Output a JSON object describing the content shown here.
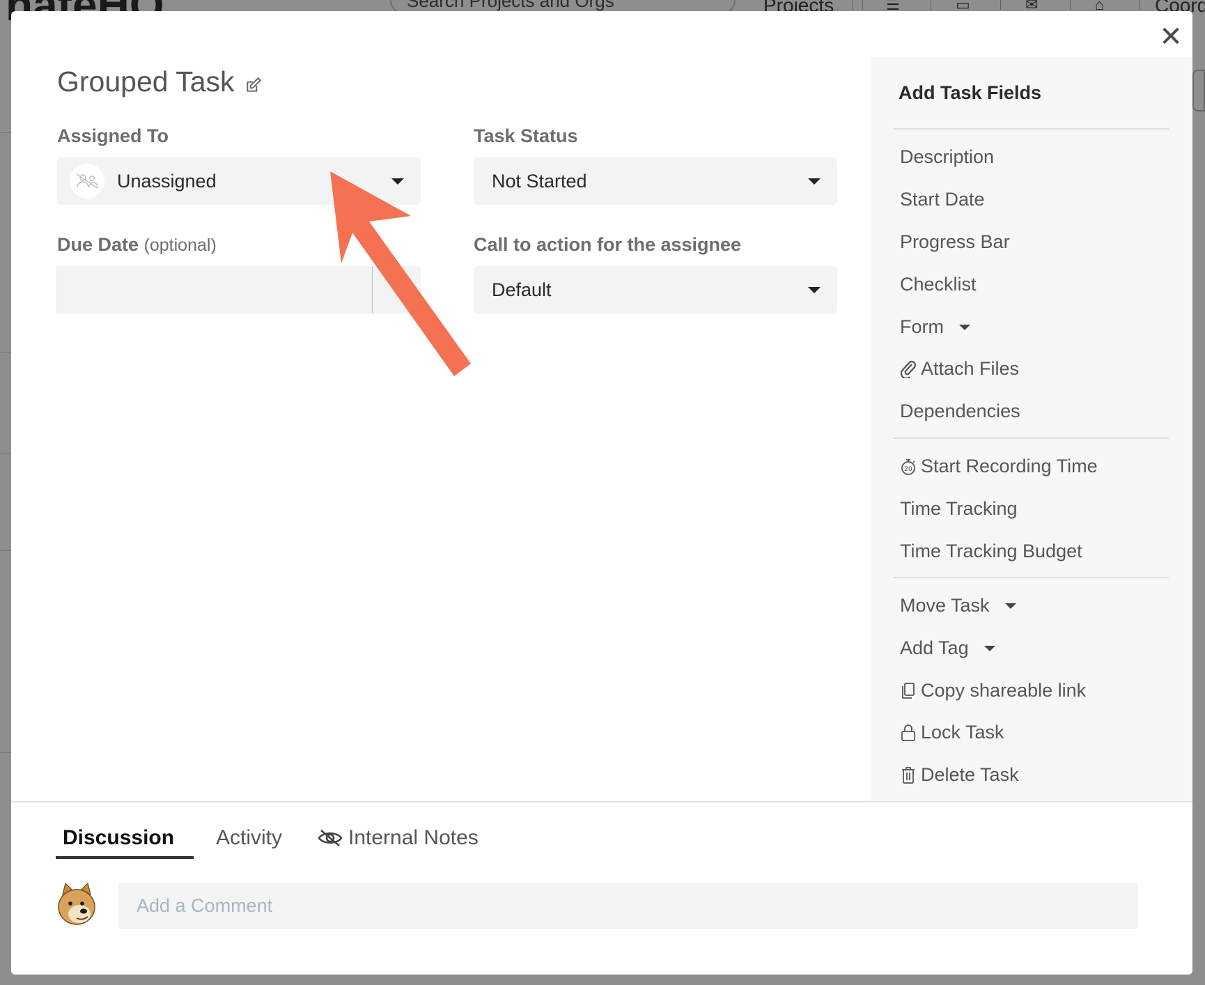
{
  "background": {
    "logo_text": "nateHQ",
    "search_placeholder": "Search Projects and Orgs",
    "nav_projects": "Projects",
    "nav_coord": "Coord"
  },
  "modal": {
    "title": "Grouped Task",
    "close_label": "✕"
  },
  "fields": {
    "assigned_to_label": "Assigned To",
    "assigned_to_value": "Unassigned",
    "task_status_label": "Task Status",
    "task_status_value": "Not Started",
    "due_date_label": "Due Date",
    "due_date_optional": "(optional)",
    "due_date_value": "",
    "cta_label": "Call to action for the assignee",
    "cta_value": "Default"
  },
  "sidebar": {
    "title": "Add Task Fields",
    "group1": [
      "Description",
      "Start Date",
      "Progress Bar",
      "Checklist",
      "Form",
      "Attach Files",
      "Dependencies"
    ],
    "group2": [
      "Start Recording Time",
      "Time Tracking",
      "Time Tracking Budget"
    ],
    "group3": [
      "Move Task",
      "Add Tag",
      "Copy shareable link",
      "Lock Task",
      "Delete Task"
    ]
  },
  "tabs": {
    "discussion": "Discussion",
    "activity": "Activity",
    "internal_notes": "Internal Notes"
  },
  "comment": {
    "placeholder": "Add a Comment"
  },
  "colors": {
    "annotation_arrow": "#f47152",
    "overlay": "#8e8e8e",
    "panel_bg": "#f7f7f7",
    "field_bg": "#f3f3f3"
  }
}
